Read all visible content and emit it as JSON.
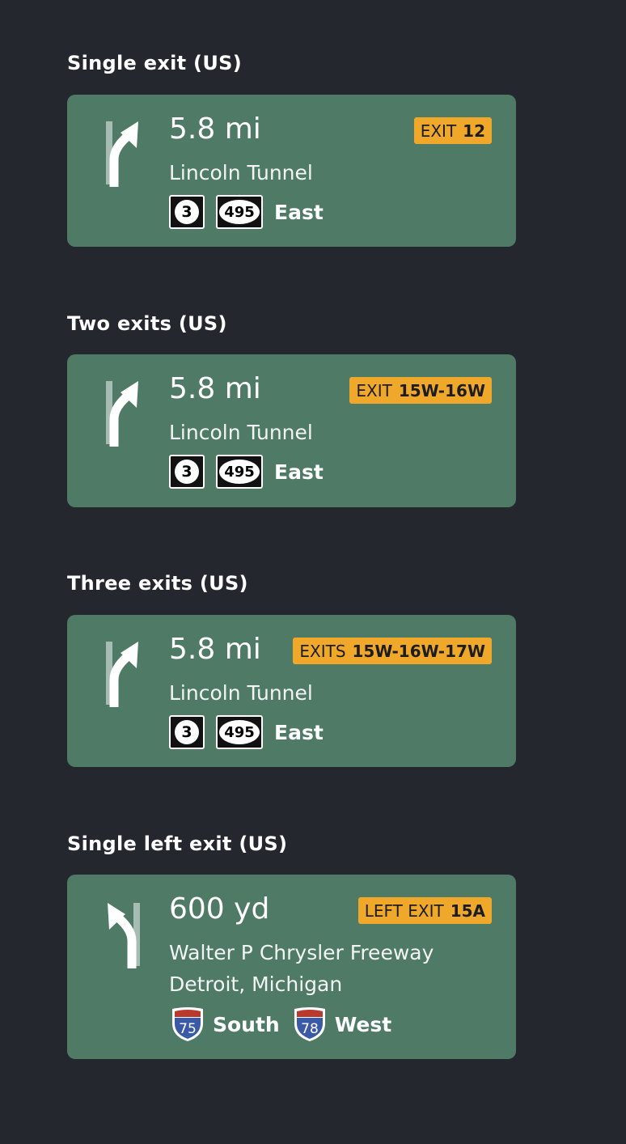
{
  "sections": [
    {
      "title": "Single exit (US)",
      "distance": "5.8 mi",
      "exit_kind": "EXIT",
      "exit_number": "12",
      "street": "Lincoln Tunnel",
      "shields": [
        {
          "route": "3",
          "type": "state-square"
        },
        {
          "route": "495",
          "type": "state-oval"
        }
      ],
      "direction": "East",
      "arrow": "slight-right-arrow-icon"
    },
    {
      "title": "Two exits (US)",
      "distance": "5.8 mi",
      "exit_kind": "EXIT",
      "exit_number": "15W-16W",
      "street": "Lincoln Tunnel",
      "shields": [
        {
          "route": "3",
          "type": "state-square"
        },
        {
          "route": "495",
          "type": "state-oval"
        }
      ],
      "direction": "East",
      "arrow": "slight-right-arrow-icon"
    },
    {
      "title": "Three exits (US)",
      "distance": "5.8 mi",
      "exit_kind": "EXITS",
      "exit_number": "15W-16W-17W",
      "street": "Lincoln Tunnel",
      "shields": [
        {
          "route": "3",
          "type": "state-square"
        },
        {
          "route": "495",
          "type": "state-oval"
        }
      ],
      "direction": "East",
      "arrow": "slight-right-arrow-icon"
    },
    {
      "title": "Single left exit (US)",
      "distance": "600 yd",
      "exit_kind": "LEFT EXIT",
      "exit_number": "15A",
      "street": "Walter P Chrysler Freeway",
      "street2": "Detroit, Michigan",
      "interstates": [
        {
          "route": "75",
          "direction": "South"
        },
        {
          "route": "78",
          "direction": "West"
        }
      ],
      "arrow": "slight-left-arrow-icon"
    }
  ],
  "colors": {
    "background": "#25272e",
    "card": "#4f7a66",
    "exit_badge": "#f0a82a",
    "interstate_blue": "#3a5aa8",
    "interstate_red": "#b83a2e"
  }
}
